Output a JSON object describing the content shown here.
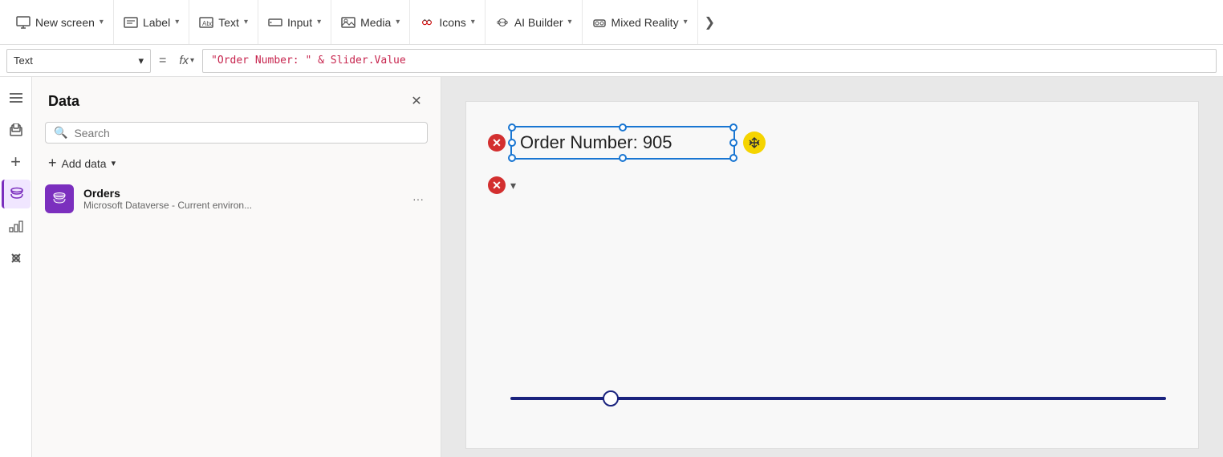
{
  "toolbar": {
    "new_screen_label": "New screen",
    "label_label": "Label",
    "text_label": "Text",
    "input_label": "Input",
    "media_label": "Media",
    "icons_label": "Icons",
    "ai_builder_label": "AI Builder",
    "mixed_reality_label": "Mixed Reality",
    "overflow_label": "⌄"
  },
  "formula_bar": {
    "property": "Text",
    "formula": "\"Order Number: \" & Slider.Value",
    "fx_label": "fx",
    "equals": "="
  },
  "data_panel": {
    "title": "Data",
    "search_placeholder": "Search",
    "add_data_label": "Add data",
    "data_sources": [
      {
        "name": "Orders",
        "description": "Microsoft Dataverse - Current environ...",
        "icon": "🗄"
      }
    ]
  },
  "canvas": {
    "text_element": "Order Number: 905",
    "slider_value": 905
  },
  "sidebar_icons": [
    {
      "name": "hamburger-menu-icon",
      "symbol": "☰",
      "active": false
    },
    {
      "name": "layers-icon",
      "symbol": "⧉",
      "active": false
    },
    {
      "name": "add-icon",
      "symbol": "+",
      "active": false
    },
    {
      "name": "data-icon",
      "symbol": "🗄",
      "active": true
    },
    {
      "name": "reports-icon",
      "symbol": "📊",
      "active": false
    },
    {
      "name": "settings-icon",
      "symbol": "⚙",
      "active": false
    }
  ]
}
